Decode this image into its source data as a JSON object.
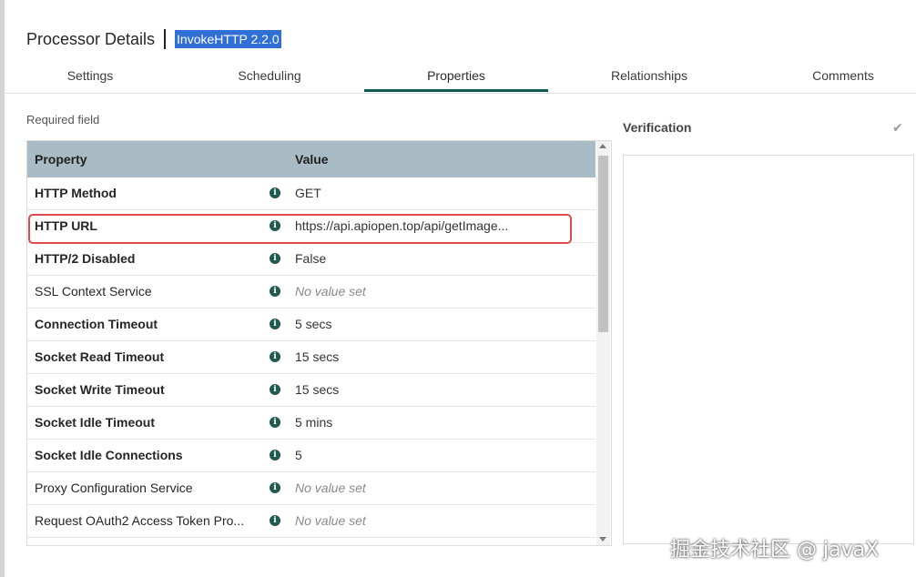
{
  "header": {
    "title": "Processor Details",
    "processor_version": "InvokeHTTP 2.2.0"
  },
  "tabs": [
    {
      "label": "Settings",
      "active": false
    },
    {
      "label": "Scheduling",
      "active": false
    },
    {
      "label": "Properties",
      "active": true
    },
    {
      "label": "Relationships",
      "active": false
    },
    {
      "label": "Comments",
      "active": false
    }
  ],
  "properties": {
    "required_label": "Required field",
    "columns": {
      "property": "Property",
      "value": "Value"
    },
    "rows": [
      {
        "name": "HTTP Method",
        "value": "GET",
        "required": true,
        "empty": false
      },
      {
        "name": "HTTP URL",
        "value": "https://api.apiopen.top/api/getImage...",
        "required": true,
        "empty": false
      },
      {
        "name": "HTTP/2 Disabled",
        "value": "False",
        "required": true,
        "empty": false
      },
      {
        "name": "SSL Context Service",
        "value": "No value set",
        "required": false,
        "empty": true
      },
      {
        "name": "Connection Timeout",
        "value": "5 secs",
        "required": true,
        "empty": false
      },
      {
        "name": "Socket Read Timeout",
        "value": "15 secs",
        "required": true,
        "empty": false
      },
      {
        "name": "Socket Write Timeout",
        "value": "15 secs",
        "required": true,
        "empty": false
      },
      {
        "name": "Socket Idle Timeout",
        "value": "5 mins",
        "required": true,
        "empty": false
      },
      {
        "name": "Socket Idle Connections",
        "value": "5",
        "required": true,
        "empty": false
      },
      {
        "name": "Proxy Configuration Service",
        "value": "No value set",
        "required": false,
        "empty": true
      },
      {
        "name": "Request OAuth2 Access Token Pro...",
        "value": "No value set",
        "required": false,
        "empty": true
      }
    ]
  },
  "verification": {
    "label": "Verification",
    "icon": "check-icon"
  },
  "watermark": "掘金技术社区 @ javaX",
  "colors": {
    "accent": "#0f5c52",
    "table_header": "#a9bcc5",
    "info_icon": "#1e5a4e",
    "highlight": "#e04a4a",
    "title_selection": "#2f6fd6"
  }
}
